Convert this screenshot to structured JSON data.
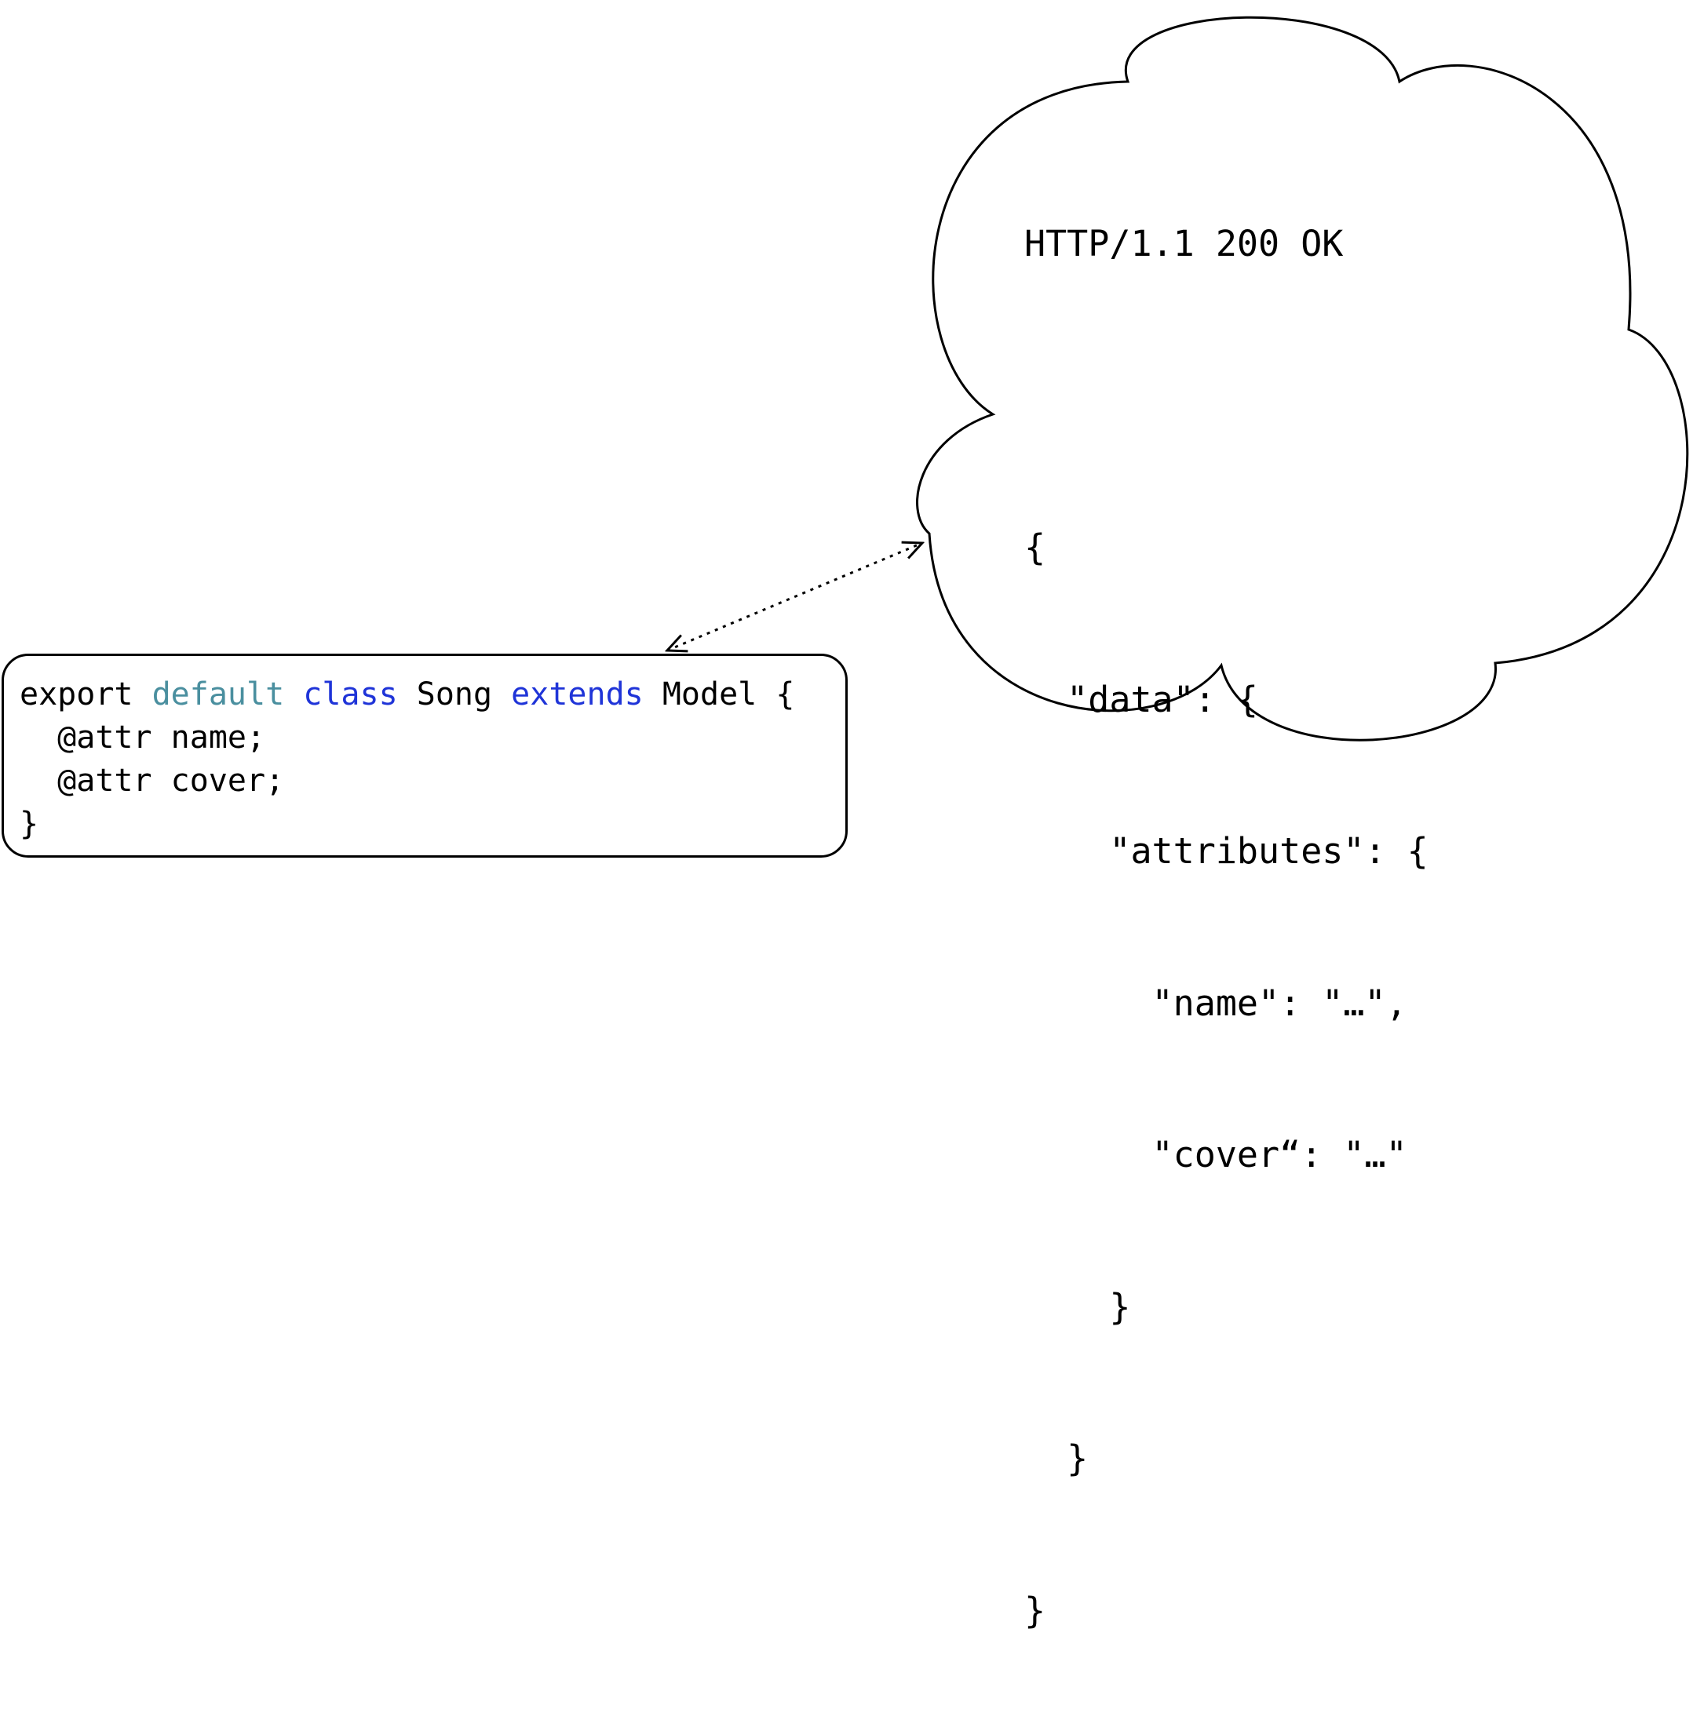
{
  "colors": {
    "keyword_teal": "#4a8f9f",
    "keyword_blue": "#1f34d8",
    "text": "#000000",
    "stroke": "#000000",
    "background": "#ffffff"
  },
  "code": {
    "line1": {
      "t1": "export ",
      "t2": "default",
      "t3": " ",
      "t4": "class",
      "t5": " Song ",
      "t6": "extends",
      "t7": " Model {"
    },
    "line2": "  @attr name;",
    "line3": "  @attr cover;",
    "line4": "}"
  },
  "response": {
    "status_line": "HTTP/1.1 200 OK",
    "body_lines": [
      "{",
      "  \"data\": {",
      "    \"attributes\": {",
      "      \"name\": \"…\",",
      "      \"cover“: \"…\"",
      "    }",
      "  }",
      "}"
    ]
  }
}
